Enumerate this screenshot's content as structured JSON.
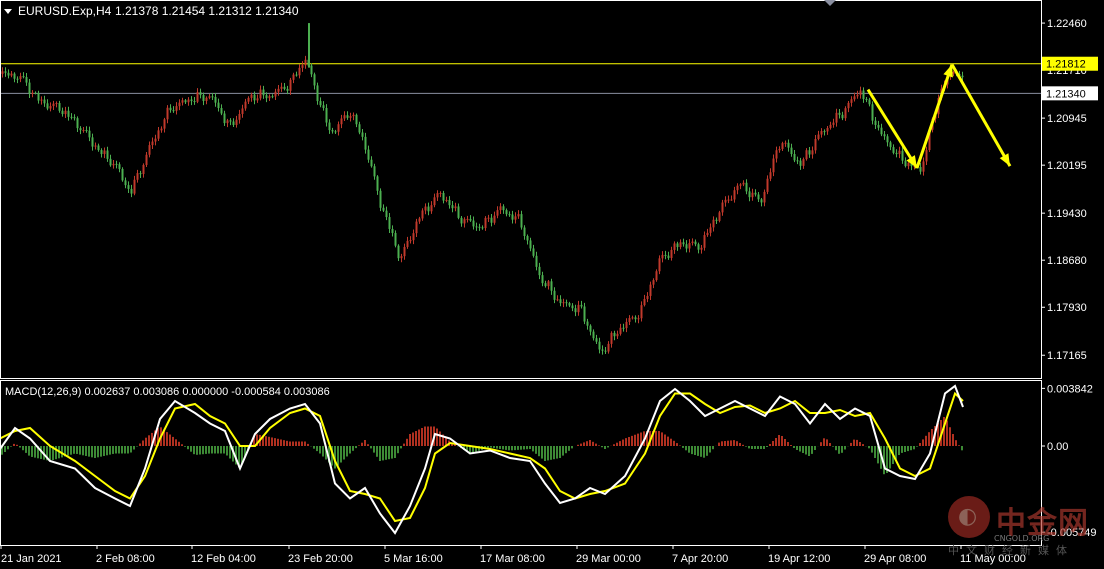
{
  "header": {
    "symbol_text": "EURUSD.Exp,H4",
    "ohlc_text": "1.21378 1.21454 1.21312 1.21340",
    "menu_icon": "triangle-down-icon"
  },
  "macd": {
    "label": "MACD(12,26,9) 0.002637 0.003086 0.000000 -0.000584 0.003086"
  },
  "watermark": {
    "logo_icon": "cngold-logo-icon",
    "title": "中金网",
    "subtitle": "CNGOLD.ORG",
    "tagline": "中文财经新媒体"
  },
  "colors": {
    "background": "#000000",
    "bull_candle": "#c0392b",
    "bear_candle": "#4caf50",
    "axis": "#ffffff",
    "yellow_line": "#ffff00",
    "gray_line": "#8a8fa0",
    "macd_signal": "#ffff00",
    "macd_main": "#ffffff"
  },
  "chart_data": [
    {
      "type": "candlestick",
      "title": "EURUSD.Exp,H4",
      "ylim": [
        1.1685,
        1.2278
      ],
      "y_ticks": [
        "1.22460",
        "1.21710",
        "1.20945",
        "1.20195",
        "1.19430",
        "1.18680",
        "1.17930",
        "1.17165"
      ],
      "x_ticks": [
        "21 Jan 2021",
        "2 Feb 08:00",
        "12 Feb 04:00",
        "23 Feb 20:00",
        "5 Mar 16:00",
        "17 Mar 08:00",
        "29 Mar 00:00",
        "7 Apr 20:00",
        "19 Apr 12:00",
        "29 Apr 08:00",
        "11 May 00:00"
      ],
      "close_path": [
        [
          0,
          1.2165
        ],
        [
          20,
          1.216
        ],
        [
          40,
          1.212
        ],
        [
          60,
          1.211
        ],
        [
          80,
          1.208
        ],
        [
          100,
          1.204
        ],
        [
          115,
          1.202
        ],
        [
          130,
          1.1975
        ],
        [
          150,
          1.205
        ],
        [
          170,
          1.211
        ],
        [
          190,
          1.2125
        ],
        [
          210,
          1.213
        ],
        [
          230,
          1.208
        ],
        [
          250,
          1.213
        ],
        [
          270,
          1.213
        ],
        [
          290,
          1.215
        ],
        [
          305,
          1.219
        ],
        [
          315,
          1.214
        ],
        [
          330,
          1.207
        ],
        [
          350,
          1.2105
        ],
        [
          365,
          1.205
        ],
        [
          380,
          1.196
        ],
        [
          400,
          1.187
        ],
        [
          420,
          1.194
        ],
        [
          440,
          1.1975
        ],
        [
          460,
          1.1935
        ],
        [
          480,
          1.192
        ],
        [
          500,
          1.195
        ],
        [
          520,
          1.193
        ],
        [
          540,
          1.184
        ],
        [
          560,
          1.18
        ],
        [
          580,
          1.179
        ],
        [
          600,
          1.172
        ],
        [
          620,
          1.176
        ],
        [
          640,
          1.1785
        ],
        [
          660,
          1.187
        ],
        [
          680,
          1.1895
        ],
        [
          700,
          1.189
        ],
        [
          720,
          1.195
        ],
        [
          740,
          1.199
        ],
        [
          760,
          1.196
        ],
        [
          780,
          1.206
        ],
        [
          800,
          1.202
        ],
        [
          820,
          1.207
        ],
        [
          840,
          1.21
        ],
        [
          860,
          1.214
        ],
        [
          880,
          1.207
        ],
        [
          900,
          1.203
        ],
        [
          920,
          1.201
        ],
        [
          940,
          1.214
        ],
        [
          955,
          1.2175
        ],
        [
          965,
          1.214
        ]
      ],
      "price_labels": [
        {
          "value": 1.21812,
          "text": "1.21812",
          "style": "yellow"
        },
        {
          "value": 1.2134,
          "text": "1.21340",
          "style": "gray"
        }
      ],
      "arrows": [
        {
          "from": [
            868,
            1.214
          ],
          "to": [
            917,
            1.2015
          ]
        },
        {
          "from": [
            917,
            1.2015
          ],
          "to": [
            952,
            1.218
          ]
        },
        {
          "from": [
            952,
            1.218
          ],
          "to": [
            1010,
            1.2018
          ]
        }
      ]
    },
    {
      "type": "macd",
      "title": "MACD(12,26,9)",
      "ylim": [
        -0.0064,
        0.0042
      ],
      "y_ticks": [
        "0.003842",
        "0.00",
        "-0.005749"
      ],
      "params": [
        12,
        26,
        9
      ],
      "values": {
        "macd": 0.002637,
        "signal": 0.003086,
        "histogram": -0.000584
      },
      "main_path": [
        [
          0,
          -0.0002
        ],
        [
          15,
          0.0012
        ],
        [
          30,
          0.0005
        ],
        [
          50,
          -0.001
        ],
        [
          75,
          -0.0015
        ],
        [
          95,
          -0.0028
        ],
        [
          115,
          -0.0035
        ],
        [
          130,
          -0.004
        ],
        [
          145,
          -0.0015
        ],
        [
          160,
          0.0018
        ],
        [
          175,
          0.003
        ],
        [
          195,
          0.0022
        ],
        [
          210,
          0.0015
        ],
        [
          225,
          0.001
        ],
        [
          240,
          -0.0015
        ],
        [
          255,
          0.0008
        ],
        [
          270,
          0.0018
        ],
        [
          290,
          0.0025
        ],
        [
          305,
          0.0028
        ],
        [
          320,
          0.0015
        ],
        [
          335,
          -0.0025
        ],
        [
          350,
          -0.0035
        ],
        [
          365,
          -0.0028
        ],
        [
          380,
          -0.0045
        ],
        [
          395,
          -0.0058
        ],
        [
          410,
          -0.004
        ],
        [
          425,
          -0.0015
        ],
        [
          435,
          0.0008
        ],
        [
          450,
          0.0005
        ],
        [
          470,
          -0.0005
        ],
        [
          490,
          -0.0003
        ],
        [
          510,
          -0.0008
        ],
        [
          530,
          -0.001
        ],
        [
          545,
          -0.0025
        ],
        [
          560,
          -0.0038
        ],
        [
          575,
          -0.0035
        ],
        [
          590,
          -0.0028
        ],
        [
          605,
          -0.0032
        ],
        [
          625,
          -0.002
        ],
        [
          645,
          0.0005
        ],
        [
          660,
          0.003
        ],
        [
          675,
          0.0038
        ],
        [
          690,
          0.003
        ],
        [
          705,
          0.002
        ],
        [
          720,
          0.0025
        ],
        [
          735,
          0.003
        ],
        [
          750,
          0.0025
        ],
        [
          765,
          0.002
        ],
        [
          780,
          0.0033
        ],
        [
          795,
          0.0028
        ],
        [
          810,
          0.0015
        ],
        [
          825,
          0.0028
        ],
        [
          840,
          0.0018
        ],
        [
          855,
          0.0025
        ],
        [
          870,
          0.002
        ],
        [
          885,
          -0.0015
        ],
        [
          900,
          -0.002
        ],
        [
          915,
          -0.0022
        ],
        [
          930,
          -0.0005
        ],
        [
          945,
          0.0035
        ],
        [
          955,
          0.004
        ],
        [
          963,
          0.0026
        ]
      ],
      "signal_path": [
        [
          0,
          0.0005
        ],
        [
          15,
          0.001
        ],
        [
          30,
          0.0012
        ],
        [
          50,
          0.0
        ],
        [
          75,
          -0.001
        ],
        [
          95,
          -0.002
        ],
        [
          115,
          -0.003
        ],
        [
          130,
          -0.0035
        ],
        [
          145,
          -0.002
        ],
        [
          160,
          0.0005
        ],
        [
          175,
          0.0025
        ],
        [
          195,
          0.0028
        ],
        [
          210,
          0.002
        ],
        [
          225,
          0.0015
        ],
        [
          240,
          0.0
        ],
        [
          255,
          0.0
        ],
        [
          270,
          0.0012
        ],
        [
          290,
          0.0022
        ],
        [
          305,
          0.0025
        ],
        [
          320,
          0.002
        ],
        [
          335,
          -0.001
        ],
        [
          350,
          -0.003
        ],
        [
          365,
          -0.0032
        ],
        [
          380,
          -0.0035
        ],
        [
          395,
          -0.005
        ],
        [
          410,
          -0.0048
        ],
        [
          425,
          -0.0028
        ],
        [
          435,
          -0.0005
        ],
        [
          450,
          0.0002
        ],
        [
          470,
          0.0
        ],
        [
          490,
          -0.0002
        ],
        [
          510,
          -0.0005
        ],
        [
          530,
          -0.0008
        ],
        [
          545,
          -0.0015
        ],
        [
          560,
          -0.003
        ],
        [
          575,
          -0.0035
        ],
        [
          590,
          -0.0032
        ],
        [
          605,
          -0.003
        ],
        [
          625,
          -0.0025
        ],
        [
          645,
          -0.0005
        ],
        [
          660,
          0.002
        ],
        [
          675,
          0.0035
        ],
        [
          690,
          0.0035
        ],
        [
          705,
          0.0028
        ],
        [
          720,
          0.0022
        ],
        [
          735,
          0.0026
        ],
        [
          750,
          0.0027
        ],
        [
          765,
          0.0022
        ],
        [
          780,
          0.0025
        ],
        [
          795,
          0.003
        ],
        [
          810,
          0.0022
        ],
        [
          825,
          0.0022
        ],
        [
          840,
          0.0024
        ],
        [
          855,
          0.002
        ],
        [
          870,
          0.0022
        ],
        [
          885,
          0.0005
        ],
        [
          900,
          -0.0015
        ],
        [
          915,
          -0.002
        ],
        [
          930,
          -0.0015
        ],
        [
          945,
          0.0015
        ],
        [
          955,
          0.0035
        ],
        [
          963,
          0.003
        ]
      ]
    }
  ]
}
